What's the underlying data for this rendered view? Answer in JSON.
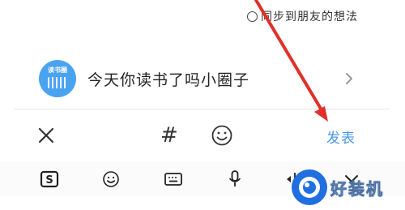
{
  "sync": {
    "label": "同步到朋友的想法",
    "checked": false
  },
  "circle": {
    "avatar_text": "读书圈",
    "title": "今天你读书了吗小圈子"
  },
  "toolbar": {
    "hash_label": "#",
    "post_label": "发表"
  },
  "keyboard_bar": {
    "s_label": "S"
  },
  "watermark": {
    "text": "好装机"
  },
  "colors": {
    "accent": "#4a98e8",
    "avatar": "#4aa3f0",
    "arrow": "#e0302a",
    "watermark_logo": "#1f6fe0"
  },
  "icons": [
    "radio-circle-icon",
    "chevron-right-icon",
    "close-icon",
    "hashtag-icon",
    "emoji-icon",
    "sogou-s-icon",
    "keyboard-icon",
    "microphone-icon",
    "cursor-move-icon",
    "chevron-down-icon"
  ]
}
